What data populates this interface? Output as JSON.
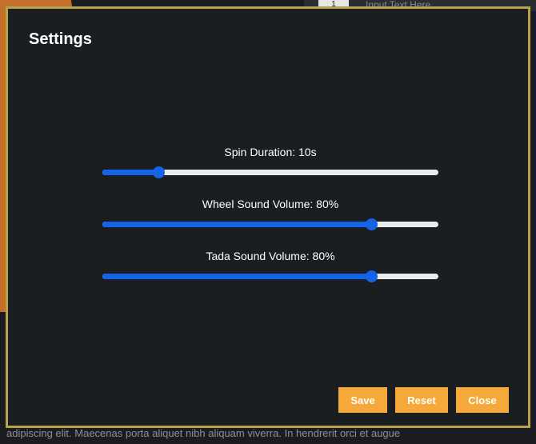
{
  "background": {
    "index_value": "1",
    "input_placeholder": "Input Text Here",
    "bottom_text": "adipiscing elit. Maecenas porta aliquet nibh aliquam viverra. In hendrerit orci et augue"
  },
  "modal": {
    "title": "Settings",
    "settings": [
      {
        "label": "Spin Duration: 10s",
        "fraction": 0.167
      },
      {
        "label": "Wheel Sound Volume: 80%",
        "fraction": 0.8
      },
      {
        "label": "Tada Sound Volume: 80%",
        "fraction": 0.8
      }
    ],
    "buttons": {
      "save": "Save",
      "reset": "Reset",
      "close": "Close"
    }
  },
  "colors": {
    "accent_button": "#f5a93b",
    "slider_blue": "#1463e8",
    "modal_border": "#b7a34a"
  }
}
